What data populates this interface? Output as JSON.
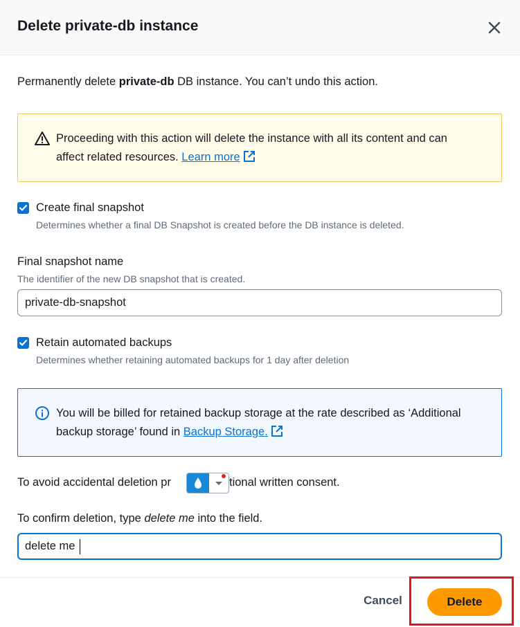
{
  "modal": {
    "title": "Delete private-db instance",
    "intro_prefix": "Permanently delete ",
    "intro_bold": "private-db",
    "intro_suffix": " DB instance. You can’t undo this action."
  },
  "warning": {
    "icon": "warning-icon",
    "text": "Proceeding with this action will delete the instance with all its content and can affect related resources. ",
    "link": "Learn more"
  },
  "final_snapshot": {
    "checked": true,
    "label": "Create final snapshot",
    "description": "Determines whether a final DB Snapshot is created before the DB instance is deleted."
  },
  "snapshot_name": {
    "label": "Final snapshot name",
    "description": "The identifier of the new DB snapshot that is created.",
    "value": "private-db-snapshot"
  },
  "retain_backups": {
    "checked": true,
    "label": "Retain automated backups",
    "description": "Determines whether retaining automated backups for 1 day after deletion"
  },
  "info": {
    "icon": "info-icon",
    "text": "You will be billed for retained backup storage at the rate described as ‘Additional backup storage’ found in ",
    "link": "Backup Storage."
  },
  "consent": {
    "text": "To avoid accidental deletion pr",
    "text_end": "dditional written consent."
  },
  "confirm": {
    "label_prefix": "To confirm deletion, type ",
    "label_em": "delete me",
    "label_suffix": " into the field.",
    "value": "delete me"
  },
  "footer": {
    "cancel_label": "Cancel",
    "delete_label": "Delete"
  },
  "colors": {
    "primary": "#ff9900",
    "link": "#0972d3",
    "warning_bg": "#fffce9",
    "info_bg": "#f2f8fd",
    "highlight": "#e3151b"
  }
}
